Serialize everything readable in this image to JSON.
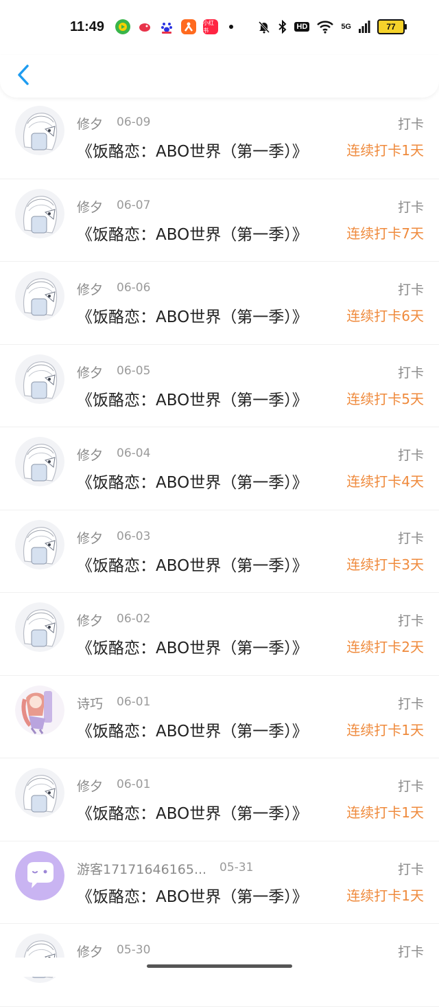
{
  "status_bar": {
    "time": "11:49",
    "icons": [
      "music-app-icon",
      "bird-app-icon",
      "baidu-app-icon",
      "taobao-app-icon",
      "xiaohongshu-app-icon"
    ],
    "xhs_label": "小红书",
    "hd": "HD",
    "signal_label": "5G",
    "battery": "77"
  },
  "colors": {
    "accent": "#1e9cf0",
    "streak": "#ef8a3c",
    "meta": "#8a8a8a"
  },
  "rows": [
    {
      "user": "修夕",
      "date": "06-09",
      "title": "《饭酪恋：ABO世界（第一季）》",
      "type": "打卡",
      "streak": "连续打卡1天",
      "avatar": "sketch"
    },
    {
      "user": "修夕",
      "date": "06-07",
      "title": "《饭酪恋：ABO世界（第一季）》",
      "type": "打卡",
      "streak": "连续打卡7天",
      "avatar": "sketch"
    },
    {
      "user": "修夕",
      "date": "06-06",
      "title": "《饭酪恋：ABO世界（第一季）》",
      "type": "打卡",
      "streak": "连续打卡6天",
      "avatar": "sketch"
    },
    {
      "user": "修夕",
      "date": "06-05",
      "title": "《饭酪恋：ABO世界（第一季）》",
      "type": "打卡",
      "streak": "连续打卡5天",
      "avatar": "sketch"
    },
    {
      "user": "修夕",
      "date": "06-04",
      "title": "《饭酪恋：ABO世界（第一季）》",
      "type": "打卡",
      "streak": "连续打卡4天",
      "avatar": "sketch"
    },
    {
      "user": "修夕",
      "date": "06-03",
      "title": "《饭酪恋：ABO世界（第一季）》",
      "type": "打卡",
      "streak": "连续打卡3天",
      "avatar": "sketch"
    },
    {
      "user": "修夕",
      "date": "06-02",
      "title": "《饭酪恋：ABO世界（第一季）》",
      "type": "打卡",
      "streak": "连续打卡2天",
      "avatar": "sketch"
    },
    {
      "user": "诗巧",
      "date": "06-01",
      "title": "《饭酪恋：ABO世界（第一季）》",
      "type": "打卡",
      "streak": "连续打卡1天",
      "avatar": "anime"
    },
    {
      "user": "修夕",
      "date": "06-01",
      "title": "《饭酪恋：ABO世界（第一季）》",
      "type": "打卡",
      "streak": "连续打卡1天",
      "avatar": "sketch"
    },
    {
      "user": "游客17171646165...",
      "date": "05-31",
      "title": "《饭酪恋：ABO世界（第一季）》",
      "type": "打卡",
      "streak": "连续打卡1天",
      "avatar": "guest"
    },
    {
      "user": "修夕",
      "date": "05-30",
      "title": "",
      "type": "打卡",
      "streak": "",
      "avatar": "sketch"
    }
  ]
}
